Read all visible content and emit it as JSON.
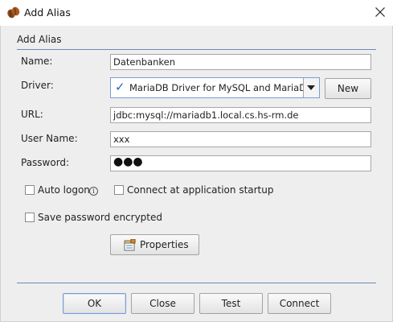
{
  "window": {
    "title": "Add Alias"
  },
  "group": {
    "title": "Add Alias"
  },
  "form": {
    "name_label": "Name:",
    "name_value": "Datenbanken",
    "driver_label": "Driver:",
    "driver_value": "MariaDB Driver for MySQL and MariaDB",
    "new_label": "New",
    "url_label": "URL:",
    "url_value": "jdbc:mysql://mariadb1.local.cs.hs-rm.de",
    "user_label": "User Name:",
    "user_value": "xxx",
    "password_label": "Password:",
    "password_mask": "●●●"
  },
  "options": {
    "auto_logon": "Auto logon",
    "info_glyph": "i",
    "connect_startup": "Connect at application startup",
    "save_encrypted": "Save password encrypted",
    "auto_logon_checked": false,
    "connect_startup_checked": false,
    "save_encrypted_checked": false
  },
  "properties_label": "Properties",
  "buttons": {
    "ok": "OK",
    "close": "Close",
    "test": "Test",
    "connect": "Connect"
  },
  "colors": {
    "accent": "#2b5fb8",
    "separator": "#6f8ab5",
    "background": "#eeeeee"
  },
  "icons": [
    "coffee-bean-icon",
    "close-icon",
    "checkmark-icon",
    "chevron-down-icon",
    "info-icon",
    "properties-icon"
  ]
}
